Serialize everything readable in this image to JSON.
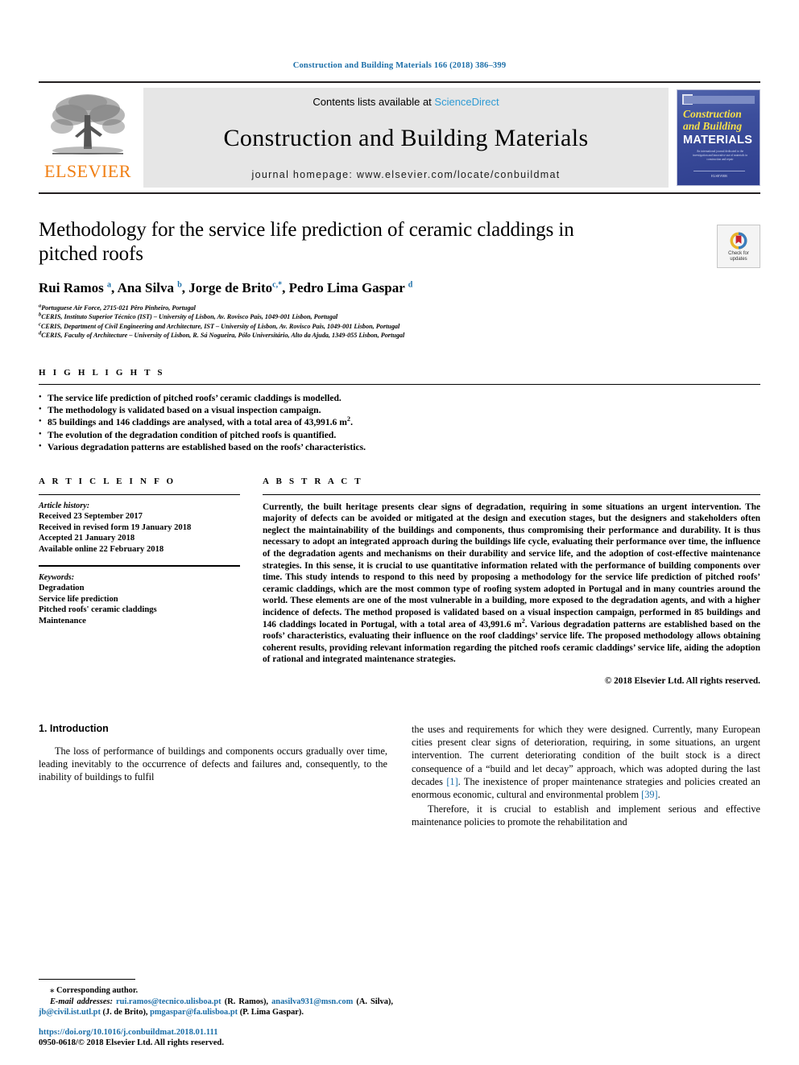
{
  "running_head": "Construction and Building Materials 166 (2018) 386–399",
  "masthead": {
    "publisher_name": "ELSEVIER",
    "contents_prefix": "Contents lists available at ",
    "contents_link": "ScienceDirect",
    "journal_title": "Construction and Building Materials",
    "homepage": "journal homepage: www.elsevier.com/locate/conbuildmat",
    "cover": {
      "line1": "Construction",
      "line2": "and Building",
      "line3": "MATERIALS",
      "blurb": "An international journal dedicated to the investigation and innovative use of materials in construction and repair",
      "footer": "ELSEVIER"
    },
    "accent_link_color": "#2f9bd4",
    "elsevier_orange": "#f07f13"
  },
  "crossmark": {
    "line1": "Check for",
    "line2": "updates"
  },
  "article": {
    "title": "Methodology for the service life prediction of ceramic claddings in pitched roofs",
    "authors_html": "Rui Ramos <sup>a</sup>, Ana Silva <sup>b</sup>, Jorge de Brito<sup>c,*</sup>, Pedro Lima Gaspar <sup>d</sup>",
    "affiliations": [
      "Portuguese Air Force, 2715-021 Pêro Pinheiro, Portugal",
      "CERIS, Instituto Superior Técnico (IST) – University of Lisbon, Av. Rovisco Pais, 1049-001 Lisbon, Portugal",
      "CERIS, Department of Civil Engineering and Architecture, IST – University of Lisbon, Av. Rovisco Pais, 1049-001 Lisbon, Portugal",
      "CERIS, Faculty of Architecture – University of Lisbon, R. Sá Nogueira, Pólo Universitário, Alto da Ajuda, 1349-055 Lisbon, Portugal"
    ],
    "affiliation_markers": [
      "a",
      "b",
      "c",
      "d"
    ]
  },
  "highlights": {
    "heading": "H I G H L I G H T S",
    "items": [
      "The service life prediction of pitched roofs’ ceramic claddings is modelled.",
      "The methodology is validated based on a visual inspection campaign.",
      "85 buildings and 146 claddings are analysed, with a total area of 43,991.6 m<sup>2</sup>.",
      "The evolution of the degradation condition of pitched roofs is quantified.",
      "Various degradation patterns are established based on the roofs’ characteristics."
    ]
  },
  "article_info": {
    "heading": "A R T I C L E   I N F O",
    "history_label": "Article history:",
    "history": [
      "Received 23 September 2017",
      "Received in revised form 19 January 2018",
      "Accepted 21 January 2018",
      "Available online 22 February 2018"
    ],
    "keywords_label": "Keywords:",
    "keywords": [
      "Degradation",
      "Service life prediction",
      "Pitched roofs' ceramic claddings",
      "Maintenance"
    ]
  },
  "abstract": {
    "heading": "A B S T R A C T",
    "body_html": "Currently, the built heritage presents clear signs of degradation, requiring in some situations an urgent intervention. The majority of defects can be avoided or mitigated at the design and execution stages, but the designers and stakeholders often neglect the maintainability of the buildings and components, thus compromising their performance and durability. It is thus necessary to adopt an integrated approach during the buildings life cycle, evaluating their performance over time, the influence of the degradation agents and mechanisms on their durability and service life, and the adoption of cost-effective maintenance strategies. In this sense, it is crucial to use quantitative information related with the performance of building components over time. This study intends to respond to this need by proposing a methodology for the service life prediction of pitched roofs’ ceramic claddings, which are the most common type of roofing system adopted in Portugal and in many countries around the world. These elements are one of the most vulnerable in a building, more exposed to the degradation agents, and with a higher incidence of defects. The method proposed is validated based on a visual inspection campaign, performed in 85 buildings and 146 claddings located in Portugal, with a total area of 43,991.6 m<sup>2</sup>. Various degradation patterns are established based on the roofs’ characteristics, evaluating their influence on the roof claddings’ service life. The proposed methodology allows obtaining coherent results, providing relevant information regarding the pitched roofs ceramic claddings’ service life, aiding the adoption of rational and integrated maintenance strategies.",
    "copyright": "© 2018 Elsevier Ltd. All rights reserved."
  },
  "introduction": {
    "heading": "1. Introduction",
    "left_paragraph": "The loss of performance of buildings and components occurs gradually over time, leading inevitably to the occurrence of defects and failures and, consequently, to the inability of buildings to fulfil",
    "right_paragraph_1_html": "the uses and requirements for which they were designed. Currently, many European cities present clear signs of deterioration, requiring, in some situations, an urgent intervention. The current deteriorating condition of the built stock is a direct consequence of a “build and let decay” approach, which was adopted during the last decades <span class=\"ref\">[1]</span>. The inexistence of proper maintenance strategies and policies created an enormous economic, cultural and environmental problem <span class=\"ref\">[39]</span>.",
    "right_paragraph_2": "Therefore, it is crucial to establish and implement serious and effective maintenance policies to promote the rehabilitation and"
  },
  "footnote": {
    "corresponding": "⁎ Corresponding author.",
    "emails_html": "<i>E-mail addresses:</i> <span class=\"link\">rui.ramos@tecnico.ulisboa.pt</span> (R. Ramos), <span class=\"link\">anasilva931@msn.com</span> (A. Silva), <span class=\"link\">jb@civil.ist.utl.pt</span> (J. de Brito), <span class=\"link\">pmgaspar@fa.ulisboa.pt</span> (P. Lima Gaspar)."
  },
  "footer": {
    "doi": "https://doi.org/10.1016/j.conbuildmat.2018.01.111",
    "issn": "0950-0618/© 2018 Elsevier Ltd. All rights reserved."
  }
}
